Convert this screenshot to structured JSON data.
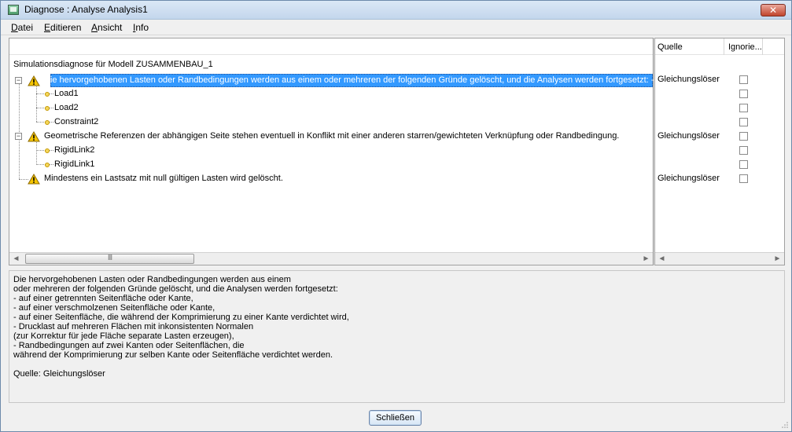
{
  "window": {
    "title": "Diagnose : Analyse Analysis1",
    "close_glyph": "✕"
  },
  "menu": [
    {
      "label": "Datei",
      "mnemonic": "D",
      "rest": "atei"
    },
    {
      "label": "Editieren",
      "mnemonic": "E",
      "rest": "ditieren"
    },
    {
      "label": "Ansicht",
      "mnemonic": "A",
      "rest": "nsicht"
    },
    {
      "label": "Info",
      "mnemonic": "I",
      "rest": "nfo"
    }
  ],
  "columns": {
    "source": "Quelle",
    "ignore": "Ignorie..."
  },
  "tree": {
    "root_label": "Simulationsdiagnose für Modell ZUSAMMENBAU_1",
    "groups": [
      {
        "text": "Die hervorgehobenen Lasten oder Randbedingungen werden aus einem oder mehreren der folgenden Gründe gelöscht, und die Analysen werden fortgesetzt: - auf e",
        "source": "Gleichungslöser",
        "children": [
          "Load1",
          "Load2",
          "Constraint2"
        ]
      },
      {
        "text": "Geometrische Referenzen der abhängigen Seite stehen eventuell in Konflikt mit einer anderen starren/gewichteten Verknüpfung oder Randbedingung.",
        "source": "Gleichungslöser",
        "children": [
          "RigidLink2",
          "RigidLink1"
        ]
      },
      {
        "text": "Mindestens ein Lastsatz mit null gültigen Lasten wird gelöscht.",
        "source": "Gleichungslöser",
        "children": []
      }
    ]
  },
  "scrollbar": {
    "left_arrow": "◄",
    "right_arrow": "►",
    "thumb_grip": "III"
  },
  "description": {
    "lines": [
      "Die hervorgehobenen Lasten oder Randbedingungen werden aus einem",
      "oder mehreren der folgenden Gründe gelöscht, und die Analysen werden fortgesetzt:",
      "- auf einer getrennten Seitenfläche oder Kante,",
      "- auf einer verschmolzenen Seitenfläche oder Kante,",
      "- auf einer Seitenfläche, die während der Komprimierung zu einer Kante verdichtet wird,",
      "- Drucklast auf mehreren Flächen mit inkonsistenten Normalen",
      "(zur Korrektur für jede Fläche separate Lasten erzeugen),",
      "- Randbedingungen auf zwei Kanten oder Seitenflächen, die",
      "während der Komprimierung zur selben Kante oder Seitenfläche verdichtet werden.",
      "",
      "Quelle: Gleichungslöser"
    ]
  },
  "buttons": {
    "close_label": "Schließen"
  },
  "colors": {
    "selection": "#3399ff",
    "warning": "#f6c600",
    "leaf": "#f5d75c"
  }
}
